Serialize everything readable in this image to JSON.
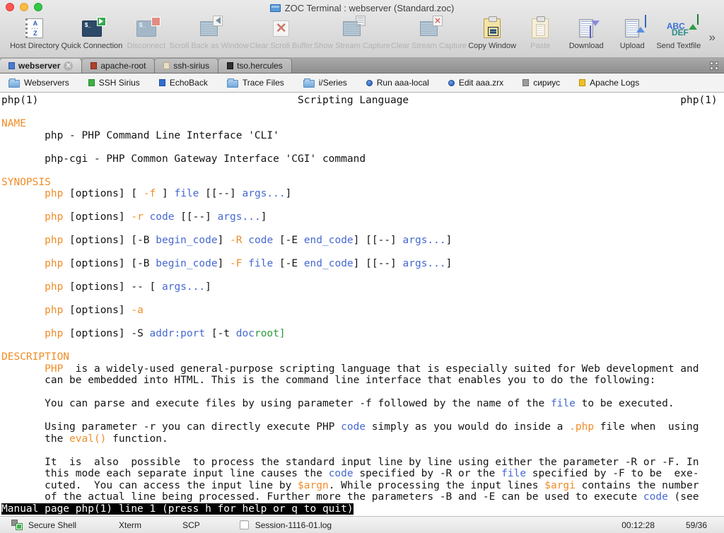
{
  "window": {
    "title": "ZOC Terminal : webserver (Standard.zoc)"
  },
  "toolbar": {
    "overflow_label": "»",
    "items": [
      {
        "label": "Host Directory",
        "icon": "host-directory",
        "enabled": true
      },
      {
        "label": "Quick Connection",
        "icon": "quick-connection",
        "enabled": true
      },
      {
        "label": "Disconnect",
        "icon": "disconnect",
        "enabled": false
      },
      {
        "label": "Scroll Back as Window",
        "icon": "scrollback-window",
        "enabled": false
      },
      {
        "label": "Clear Scroll Buffer",
        "icon": "clear-scroll",
        "enabled": false
      },
      {
        "label": "Show Stream Capture",
        "icon": "show-stream",
        "enabled": false
      },
      {
        "label": "Clear Stream Capture",
        "icon": "clear-stream",
        "enabled": false
      },
      {
        "label": "Copy Window",
        "icon": "copy-window",
        "enabled": true
      },
      {
        "label": "Paste",
        "icon": "paste",
        "enabled": false
      },
      {
        "label": "Download",
        "icon": "download",
        "enabled": true
      },
      {
        "label": "Upload",
        "icon": "upload",
        "enabled": true
      },
      {
        "label": "Send Textfile",
        "icon": "send-textfile",
        "enabled": true
      }
    ]
  },
  "tabs": [
    {
      "label": "webserver",
      "color": "#4a7ad0",
      "border": "#2f56a0",
      "active": true,
      "closable": true
    },
    {
      "label": "apache-root",
      "color": "#b2402a",
      "border": "#7e2b1c",
      "active": false,
      "closable": false
    },
    {
      "label": "ssh-sirius",
      "color": "#ecdfc6",
      "border": "#b8a988",
      "active": false,
      "closable": false
    },
    {
      "label": "tso.hercules",
      "color": "#2f2f2f",
      "border": "#111111",
      "active": false,
      "closable": false
    }
  ],
  "buttonbar": [
    {
      "label": "Webservers",
      "icon": "folder"
    },
    {
      "label": "SSH Sirius",
      "icon": "square",
      "color": "#3cb043",
      "border": "#2a8a30"
    },
    {
      "label": "EchoBack",
      "icon": "square",
      "color": "#2f6fd0",
      "border": "#204ea0"
    },
    {
      "label": "Trace Files",
      "icon": "folder"
    },
    {
      "label": "i/Series",
      "icon": "folder"
    },
    {
      "label": "Run aaa-local",
      "icon": "dot"
    },
    {
      "label": "Edit aaa.zrx",
      "icon": "dot"
    },
    {
      "label": "сириус",
      "icon": "square",
      "color": "#9c9c9c",
      "border": "#6f6f6f"
    },
    {
      "label": "Apache Logs",
      "icon": "square",
      "color": "#f0c020",
      "border": "#bb8f10"
    }
  ],
  "terminal": {
    "palette": {
      "text": "#141414",
      "orange": "#f08c28",
      "blue": "#4669d2",
      "green": "#2d9b3c"
    },
    "lines": [
      [
        [
          "php(1)                                          Scripting Language                                            php(1)",
          "k"
        ]
      ],
      [],
      [
        [
          "NAME",
          "o"
        ]
      ],
      [
        [
          "       php - PHP Command Line Interface 'CLI'",
          "k"
        ]
      ],
      [],
      [
        [
          "       php-cgi - PHP Common Gateway Interface 'CGI' command",
          "k"
        ]
      ],
      [],
      [
        [
          "SYNOPSIS",
          "o"
        ]
      ],
      [
        [
          "       ",
          "k"
        ],
        [
          "php",
          "o"
        ],
        [
          " [options] [ ",
          "k"
        ],
        [
          "-f",
          "o"
        ],
        [
          " ] ",
          "k"
        ],
        [
          "file",
          "b"
        ],
        [
          " [[--] ",
          "k"
        ],
        [
          "args...",
          "b"
        ],
        [
          "]",
          "k"
        ]
      ],
      [],
      [
        [
          "       ",
          "k"
        ],
        [
          "php",
          "o"
        ],
        [
          " [options] ",
          "k"
        ],
        [
          "-r",
          "o"
        ],
        [
          " ",
          "k"
        ],
        [
          "code",
          "b"
        ],
        [
          " [[--] ",
          "k"
        ],
        [
          "args...",
          "b"
        ],
        [
          "]",
          "k"
        ]
      ],
      [],
      [
        [
          "       ",
          "k"
        ],
        [
          "php",
          "o"
        ],
        [
          " [options] [-B ",
          "k"
        ],
        [
          "begin_code",
          "b"
        ],
        [
          "] ",
          "k"
        ],
        [
          "-R",
          "o"
        ],
        [
          " ",
          "k"
        ],
        [
          "code",
          "b"
        ],
        [
          " [-E ",
          "k"
        ],
        [
          "end_code",
          "b"
        ],
        [
          "] [[--] ",
          "k"
        ],
        [
          "args...",
          "b"
        ],
        [
          "]",
          "k"
        ]
      ],
      [],
      [
        [
          "       ",
          "k"
        ],
        [
          "php",
          "o"
        ],
        [
          " [options] [-B ",
          "k"
        ],
        [
          "begin_code",
          "b"
        ],
        [
          "] ",
          "k"
        ],
        [
          "-F",
          "o"
        ],
        [
          " ",
          "k"
        ],
        [
          "file",
          "b"
        ],
        [
          " [-E ",
          "k"
        ],
        [
          "end_code",
          "b"
        ],
        [
          "] [[--] ",
          "k"
        ],
        [
          "args...",
          "b"
        ],
        [
          "]",
          "k"
        ]
      ],
      [],
      [
        [
          "       ",
          "k"
        ],
        [
          "php",
          "o"
        ],
        [
          " [options] -- [ ",
          "k"
        ],
        [
          "args...",
          "b"
        ],
        [
          "]",
          "k"
        ]
      ],
      [],
      [
        [
          "       ",
          "k"
        ],
        [
          "php",
          "o"
        ],
        [
          " [options] ",
          "k"
        ],
        [
          "-a",
          "o"
        ]
      ],
      [],
      [
        [
          "       ",
          "k"
        ],
        [
          "php",
          "o"
        ],
        [
          " [options] -S ",
          "k"
        ],
        [
          "addr:port",
          "b"
        ],
        [
          " [-t ",
          "k"
        ],
        [
          "doc",
          "b"
        ],
        [
          "root]",
          "g"
        ]
      ],
      [],
      [
        [
          "DESCRIPTION",
          "o"
        ]
      ],
      [
        [
          "       ",
          "k"
        ],
        [
          "PHP",
          "o"
        ],
        [
          "  is a widely-used general-purpose scripting language that is especially suited for Web development and",
          "k"
        ]
      ],
      [
        [
          "       can be embedded into HTML. This is the command line interface that enables you to do the following:",
          "k"
        ]
      ],
      [],
      [
        [
          "       You can parse and execute files by using parameter -f followed by the name of the ",
          "k"
        ],
        [
          "file",
          "b"
        ],
        [
          " to be executed.",
          "k"
        ]
      ],
      [],
      [
        [
          "       Using parameter -r you can directly execute PHP ",
          "k"
        ],
        [
          "code",
          "b"
        ],
        [
          " simply as you would do inside a ",
          "k"
        ],
        [
          ".php",
          "o"
        ],
        [
          " file when  using",
          "k"
        ]
      ],
      [
        [
          "       the ",
          "k"
        ],
        [
          "eval()",
          "o"
        ],
        [
          " function.",
          "k"
        ]
      ],
      [],
      [
        [
          "       It  is  also  possible  to process the standard input line by line using either the parameter -R or -F. In",
          "k"
        ]
      ],
      [
        [
          "       this mode each separate input line causes the ",
          "k"
        ],
        [
          "code",
          "b"
        ],
        [
          " specified by -R or the ",
          "k"
        ],
        [
          "file",
          "b"
        ],
        [
          " specified by -F to be  exe-",
          "k"
        ]
      ],
      [
        [
          "       cuted.  You can access the input line by ",
          "k"
        ],
        [
          "$argn",
          "o"
        ],
        [
          ". While processing the input lines ",
          "k"
        ],
        [
          "$argi",
          "o"
        ],
        [
          " contains the number",
          "k"
        ]
      ],
      [
        [
          "       of the actual line being processed. Further more the parameters -B and -E can be used to execute ",
          "k"
        ],
        [
          "code",
          "b"
        ],
        [
          " (see",
          "k"
        ]
      ],
      [
        [
          "Manual page php(1) line 1 (press h for help or q to quit)",
          "w"
        ]
      ]
    ]
  },
  "statusbar": {
    "connection_type": "Secure Shell",
    "emulation": "Xterm",
    "transfer": "SCP",
    "log_file": "Session-1116-01.log",
    "time": "00:12:28",
    "position": "59/36"
  }
}
